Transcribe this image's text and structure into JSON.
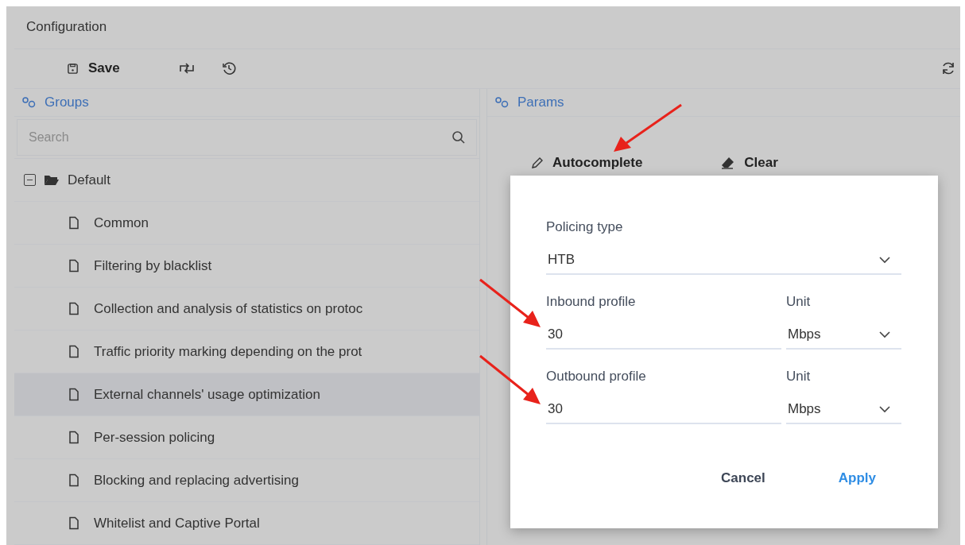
{
  "header": {
    "title": "Configuration"
  },
  "toolbar": {
    "save_label": "Save"
  },
  "groups_panel": {
    "title": "Groups",
    "search": {
      "placeholder": "Search"
    },
    "tree": [
      {
        "label": "Default",
        "expanded": true,
        "children": [
          {
            "label": "Common",
            "selected": false
          },
          {
            "label": "Filtering by blacklist",
            "selected": false
          },
          {
            "label": "Collection and analysis of statistics on protoc",
            "selected": false
          },
          {
            "label": "Traffic priority marking depending on the prot",
            "selected": false
          },
          {
            "label": "External channels' usage optimization",
            "selected": true
          },
          {
            "label": "Per-session policing",
            "selected": false
          },
          {
            "label": "Blocking and replacing advertising",
            "selected": false
          },
          {
            "label": "Whitelist and Captive Portal",
            "selected": false
          }
        ]
      }
    ]
  },
  "params_panel": {
    "title": "Params",
    "actions": [
      "Autocomplete",
      "Clear"
    ]
  },
  "popup": {
    "policing_type": {
      "label": "Policing type",
      "value": "HTB"
    },
    "profiles": [
      {
        "label": "Inbound profile",
        "value": "30",
        "unit_label": "Unit",
        "unit": "Mbps"
      },
      {
        "label": "Outbound profile",
        "value": "30",
        "unit_label": "Unit",
        "unit": "Mbps"
      }
    ],
    "buttons": [
      {
        "label": "Cancel",
        "kind": "secondary"
      },
      {
        "label": "Apply",
        "kind": "primary"
      }
    ]
  }
}
